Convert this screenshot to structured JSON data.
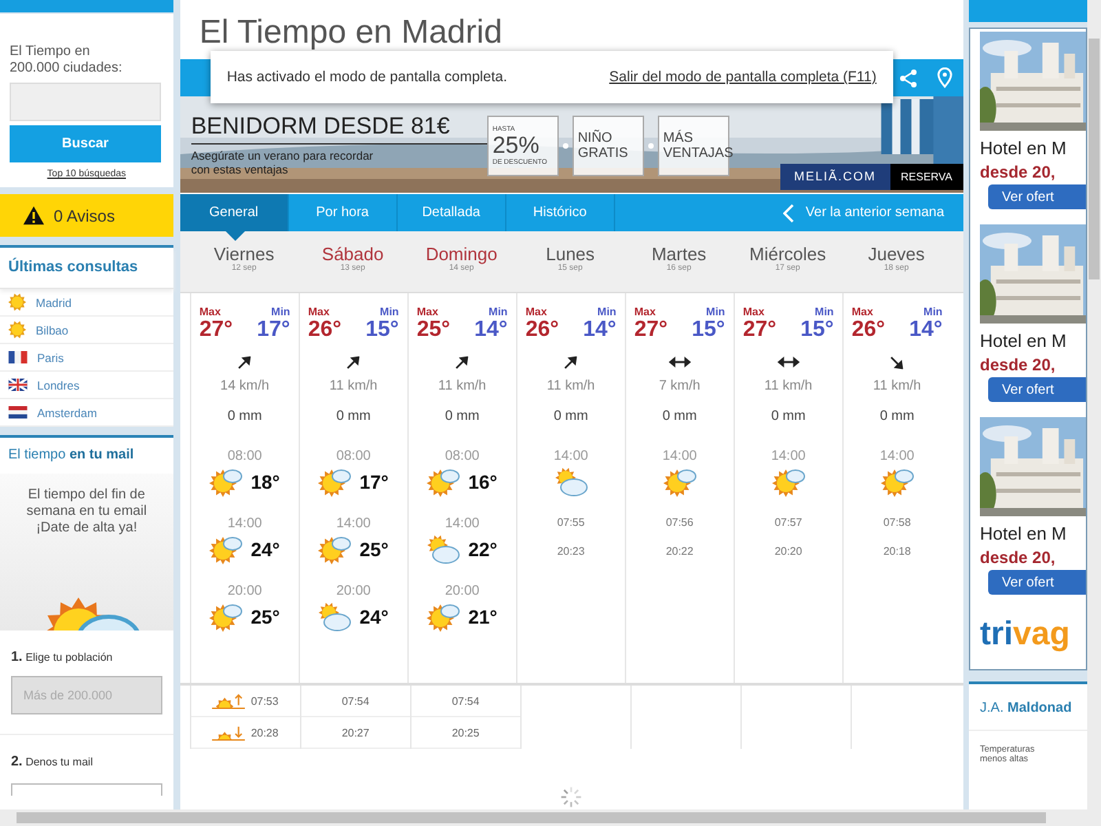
{
  "sidebar": {
    "search_label": "El Tiempo en 200.000 ciudades:",
    "search_button": "Buscar",
    "top_link": "Top 10 búsquedas",
    "alerts": "0 Avisos",
    "recent_title": "Últimas consultas",
    "recent": [
      {
        "name": "Madrid",
        "kind": "sun"
      },
      {
        "name": "Bilbao",
        "kind": "sun"
      },
      {
        "name": "Paris",
        "kind": "flag-fr"
      },
      {
        "name": "Londres",
        "kind": "flag-uk"
      },
      {
        "name": "Amsterdam",
        "kind": "flag-nl"
      }
    ],
    "mail_title": "El tiempo **en tu mail**",
    "mail_text": "El tiempo del fin de semana en tu email",
    "mail_cta": "¡Date de alta ya!",
    "step1": "**1.** Elige tu población",
    "step1_value": "Más de 200.000",
    "step2": "**2.** Denos tu mail"
  },
  "title": "El Tiempo en Madrid",
  "notice": {
    "text": "Has activado el modo de pantalla completa.",
    "link": "Salir del modo de pantalla completa (F11)"
  },
  "ad": {
    "headline": "BENIDORM DESDE 81€",
    "subline": "Asegúrate un verano para recordar con estas ventajas",
    "offers": [
      {
        "small": "HASTA",
        "big": "25%",
        "foot": "DE DESCUENTO"
      },
      {
        "big": "NIÑO GRATIS"
      },
      {
        "big": "MÁS VENTAJAS"
      }
    ],
    "brand": "MELIÃ.COM",
    "cta": "RESERVA"
  },
  "tabs": [
    {
      "label": "General",
      "selected": true
    },
    {
      "label": "Por hora",
      "selected": false
    },
    {
      "label": "Detallada",
      "selected": false
    },
    {
      "label": "Histórico",
      "selected": false
    }
  ],
  "prev_week": "Ver la anterior semana",
  "days": [
    {
      "name": "Viernes",
      "date": "12 sep",
      "weekend": false,
      "max_label": "Max",
      "max": "27°",
      "min_label": "Min",
      "min": "17°",
      "wind": {
        "kind": "ne"
      },
      "speed": "14 km/h",
      "rain": "0 mm",
      "kind": "detailed",
      "periods": [
        {
          "time": "08:00",
          "kind": "sun-cloud",
          "temp": "18°"
        },
        {
          "time": "14:00",
          "kind": "sun-cloud",
          "temp": "24°"
        },
        {
          "time": "20:00",
          "kind": "sun-cloud",
          "temp": "25°"
        }
      ],
      "sunrise": "07:53",
      "sunset": "20:28"
    },
    {
      "name": "Sábado",
      "date": "13 sep",
      "weekend": true,
      "max_label": "Max",
      "max": "26°",
      "min_label": "Min",
      "min": "15°",
      "wind": {
        "kind": "ne"
      },
      "speed": "11 km/h",
      "rain": "0 mm",
      "kind": "detailed",
      "periods": [
        {
          "time": "08:00",
          "kind": "sun-cloud",
          "temp": "17°"
        },
        {
          "time": "14:00",
          "kind": "sun-cloud",
          "temp": "25°"
        },
        {
          "time": "20:00",
          "kind": "cloud",
          "temp": "24°"
        }
      ],
      "sunrise": "07:54",
      "sunset": "20:27"
    },
    {
      "name": "Domingo",
      "date": "14 sep",
      "weekend": true,
      "max_label": "Max",
      "max": "25°",
      "min_label": "Min",
      "min": "14°",
      "wind": {
        "kind": "ne"
      },
      "speed": "11 km/h",
      "rain": "0 mm",
      "kind": "detailed",
      "periods": [
        {
          "time": "08:00",
          "kind": "sun-cloud",
          "temp": "16°"
        },
        {
          "time": "14:00",
          "kind": "cloud",
          "temp": "22°"
        },
        {
          "time": "20:00",
          "kind": "sun-cloud",
          "temp": "21°"
        }
      ],
      "sunrise": "07:54",
      "sunset": "20:25"
    },
    {
      "name": "Lunes",
      "date": "15 sep",
      "weekend": false,
      "max_label": "Max",
      "max": "26°",
      "min_label": "Min",
      "min": "14°",
      "wind": {
        "kind": "ne"
      },
      "speed": "11 km/h",
      "rain": "0 mm",
      "kind": "summary",
      "periods": [
        {
          "time": "14:00",
          "kind": "cloud"
        }
      ],
      "sunrise": "07:55",
      "sunset": "20:23"
    },
    {
      "name": "Martes",
      "date": "16 sep",
      "weekend": false,
      "max_label": "Max",
      "max": "27°",
      "min_label": "Min",
      "min": "15°",
      "wind": {
        "kind": "ew"
      },
      "speed": "7 km/h",
      "rain": "0 mm",
      "kind": "summary",
      "periods": [
        {
          "time": "14:00",
          "kind": "sun-cloud"
        }
      ],
      "sunrise": "07:56",
      "sunset": "20:22"
    },
    {
      "name": "Miércoles",
      "date": "17 sep",
      "weekend": false,
      "max_label": "Max",
      "max": "27°",
      "min_label": "Min",
      "min": "15°",
      "wind": {
        "kind": "ew"
      },
      "speed": "11 km/h",
      "rain": "0 mm",
      "kind": "summary",
      "periods": [
        {
          "time": "14:00",
          "kind": "sun-cloud"
        }
      ],
      "sunrise": "07:57",
      "sunset": "20:20"
    },
    {
      "name": "Jueves",
      "date": "18 sep",
      "weekend": false,
      "max_label": "Max",
      "max": "26°",
      "min_label": "Min",
      "min": "14°",
      "wind": {
        "kind": "se"
      },
      "speed": "11 km/h",
      "rain": "0 mm",
      "kind": "summary",
      "periods": [
        {
          "time": "14:00",
          "kind": "sun-cloud"
        }
      ],
      "sunrise": "07:58",
      "sunset": "20:18"
    }
  ],
  "promo": {
    "hotels": [
      {
        "title": "Hotel en M",
        "price": "desde 20,",
        "button": "Ver ofert"
      },
      {
        "title": "Hotel en M",
        "price": "desde 20,",
        "button": "Ver ofert"
      },
      {
        "title": "Hotel en M",
        "price": "desde 20,",
        "button": "Ver ofert"
      }
    ],
    "logo": "trivag",
    "author": "J.A. **Maldonad**",
    "note": "Temperaturas menos altas"
  }
}
